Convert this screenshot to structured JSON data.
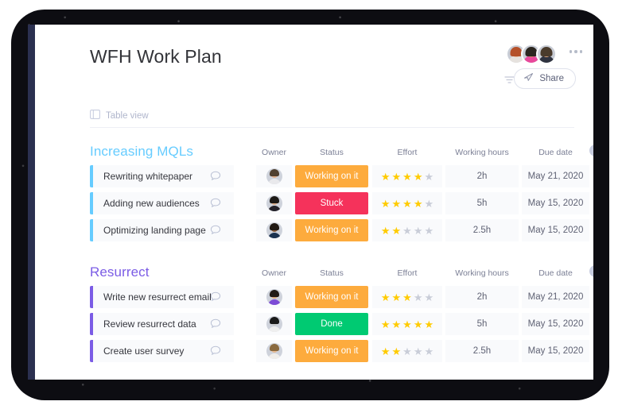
{
  "header": {
    "title": "WFH Work Plan",
    "share_label": "Share",
    "view_tab_label": "Table view",
    "more_menu": "more-options",
    "filter_icon": "filter-icon",
    "share_icon": "paper-plane-icon",
    "table_view_icon": "table-view-icon",
    "avatars": [
      {
        "name": "avatar-1",
        "skin": "#e8b99a",
        "hair": "#b5512a",
        "body": "#e6e2de"
      },
      {
        "name": "avatar-2",
        "skin": "#c98f63",
        "hair": "#2b2620",
        "body": "#e8489b"
      },
      {
        "name": "avatar-3",
        "skin": "#e0a97e",
        "hair": "#4a3b2c",
        "body": "#2f3340"
      }
    ]
  },
  "columns": {
    "owner": "Owner",
    "status": "Status",
    "effort": "Effort",
    "working_hours": "Working hours",
    "due_date": "Due date",
    "add_label": "+"
  },
  "colors": {
    "group_1": "#66ccff",
    "group_2": "#7b5ce5",
    "status_working": "#fdab3d",
    "status_stuck": "#f5325b",
    "status_done": "#00ca72",
    "star_on": "#ffcb00",
    "star_off": "#c9cdd8",
    "add_button": "#c8cde0"
  },
  "groups": [
    {
      "title": "Increasing MQLs",
      "accent": "#66ccff",
      "rows": [
        {
          "name": "Rewriting whitepaper",
          "status": "Working on it",
          "status_color": "#fdab3d",
          "effort": 4,
          "effort_max": 5,
          "working_hours": "2h",
          "due_date": "May 21, 2020",
          "owner": {
            "name": "owner-avatar",
            "skin": "#e3b08a",
            "hair": "#50402f",
            "body": "#e9e9ec"
          }
        },
        {
          "name": "Adding new audiences",
          "status": "Stuck",
          "status_color": "#f5325b",
          "effort": 4,
          "effort_max": 5,
          "working_hours": "5h",
          "due_date": "May 15, 2020",
          "owner": {
            "name": "owner-avatar",
            "skin": "#d9a987",
            "hair": "#1d1a17",
            "body": "#24222a"
          }
        },
        {
          "name": "Optimizing landing page",
          "status": "Working on it",
          "status_color": "#fdab3d",
          "effort": 2,
          "effort_max": 5,
          "working_hours": "2.5h",
          "due_date": "May 15, 2020",
          "owner": {
            "name": "owner-avatar",
            "skin": "#8a5a36",
            "hair": "#221a14",
            "body": "#1c3350"
          }
        }
      ]
    },
    {
      "title": "Resurrect",
      "accent": "#7b5ce5",
      "rows": [
        {
          "name": "Write new resurrect email",
          "status": "Working on it",
          "status_color": "#fdab3d",
          "effort": 3,
          "effort_max": 5,
          "working_hours": "2h",
          "due_date": "May 21, 2020",
          "owner": {
            "name": "owner-avatar",
            "skin": "#d8a678",
            "hair": "#221c16",
            "body": "#7c4bd6"
          }
        },
        {
          "name": "Review resurrect data",
          "status": "Done",
          "status_color": "#00ca72",
          "effort": 5,
          "effort_max": 5,
          "working_hours": "5h",
          "due_date": "May 15, 2020",
          "owner": {
            "name": "owner-avatar",
            "skin": "#c9c9c9",
            "hair": "#1a1a1a",
            "body": "#efefef"
          }
        },
        {
          "name": "Create user survey",
          "status": "Working on it",
          "status_color": "#fdab3d",
          "effort": 2,
          "effort_max": 5,
          "working_hours": "2.5h",
          "due_date": "May 15, 2020",
          "owner": {
            "name": "owner-avatar",
            "skin": "#e7b98f",
            "hair": "#8a6a3f",
            "body": "#f0eeea"
          }
        }
      ]
    }
  ]
}
